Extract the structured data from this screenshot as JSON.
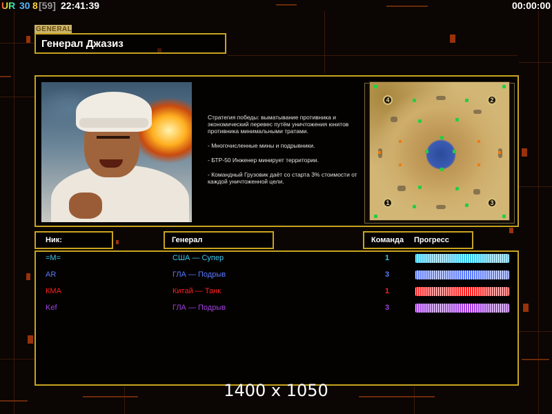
{
  "topbar": {
    "ur_label": "UR",
    "value_a": "30",
    "value_b": "8",
    "value_c": "[59]",
    "clock": "22:41:39",
    "timer": "00:00:00"
  },
  "general": {
    "tag": "GENERAL",
    "name": "Генерал Джазиз",
    "description": [
      "Стратегия победы: выматывание противника и экономический перевес путём уничтожения юнитов противника минимальными тратами.",
      "- Многочисленные мины и подрывники.",
      "- БТР-50 Инженер минирует территории.",
      "- Командный Грузовик даёт со старта 3% стоимости от каждой уничтоженной цели."
    ]
  },
  "map": {
    "players": [
      "1",
      "2",
      "3",
      "4"
    ]
  },
  "table": {
    "headers": {
      "nick": "Ник:",
      "general": "Генерал",
      "team": "Команда",
      "progress": "Прогресс"
    },
    "rows": [
      {
        "nick": "=M=",
        "general": "США — Супер",
        "team": "1",
        "color": "#3cc8f0",
        "progress": 1.0
      },
      {
        "nick": "AR",
        "general": "ГЛА — Подрыв",
        "team": "3",
        "color": "#5a7aff",
        "progress": 1.0
      },
      {
        "nick": "КМА",
        "general": "Китай — Танк",
        "team": "1",
        "color": "#ff2020",
        "progress": 1.0
      },
      {
        "nick": "Kef",
        "general": "ГЛА — Подрыв",
        "team": "3",
        "color": "#a040e0",
        "progress": 1.0
      }
    ]
  },
  "caption": "1400 x 1050",
  "colors": {
    "frame": "#c9a420",
    "accent": "#c8410f"
  }
}
